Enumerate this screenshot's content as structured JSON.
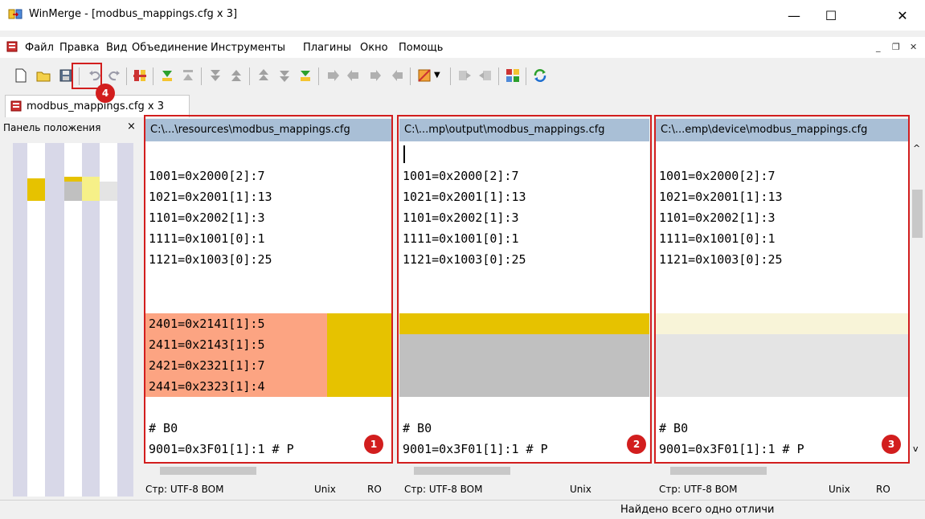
{
  "window": {
    "title": "WinMerge - [modbus_mappings.cfg x 3]",
    "minimize": "—",
    "maximize": "☐",
    "close": "✕"
  },
  "menu": {
    "items": [
      "Файл",
      "Правка",
      "Вид",
      "Объединение",
      "Инструменты",
      "Плагины",
      "Окно",
      "Помощь"
    ]
  },
  "tab": {
    "label": "modbus_mappings.cfg x 3"
  },
  "location_panel": {
    "title": "Панель положения",
    "close": "×"
  },
  "panes": [
    {
      "path": "C:\\...\\resources\\modbus_mappings.cfg",
      "badge": "1",
      "lines": [
        "1001=0x2000[2]:7",
        "1021=0x2001[1]:13",
        "1101=0x2002[1]:3",
        "1111=0x1001[0]:1",
        "1121=0x1003[0]:25",
        "2401=0x2141[1]:5",
        "2411=0x2143[1]:5",
        "2421=0x2321[1]:7",
        "2441=0x2323[1]:4",
        "# B0",
        "9001=0x3F01[1]:1 # P"
      ],
      "encoding": "Стр: UTF-8 BOM",
      "eol": "Unix",
      "ro": "RO"
    },
    {
      "path": "C:\\...mp\\output\\modbus_mappings.cfg",
      "badge": "2",
      "lines": [
        "1001=0x2000[2]:7",
        "1021=0x2001[1]:13",
        "1101=0x2002[1]:3",
        "1111=0x1001[0]:1",
        "1121=0x1003[0]:25",
        "# B0",
        "9001=0x3F01[1]:1 # P"
      ],
      "encoding": "Стр: UTF-8 BOM",
      "eol": "Unix",
      "ro": ""
    },
    {
      "path": "C:\\...emp\\device\\modbus_mappings.cfg",
      "badge": "3",
      "lines": [
        "1001=0x2000[2]:7",
        "1021=0x2001[1]:13",
        "1101=0x2002[1]:3",
        "1111=0x1001[0]:1",
        "1121=0x1003[0]:25",
        "# B0",
        "9001=0x3F01[1]:1 # P"
      ],
      "encoding": "Стр: UTF-8 BOM",
      "eol": "Unix",
      "ro": "RO"
    }
  ],
  "save_badge": "4",
  "status_message": "Найдено всего одно отличи",
  "colors": {
    "diff_orange": "#fca482",
    "diff_yellow": "#e6c200",
    "diff_gray": "#c0c0c0",
    "diff_light": "#f8f4d8",
    "highlight_red": "#d21e1e",
    "pane_header": "#a9bfd6"
  }
}
